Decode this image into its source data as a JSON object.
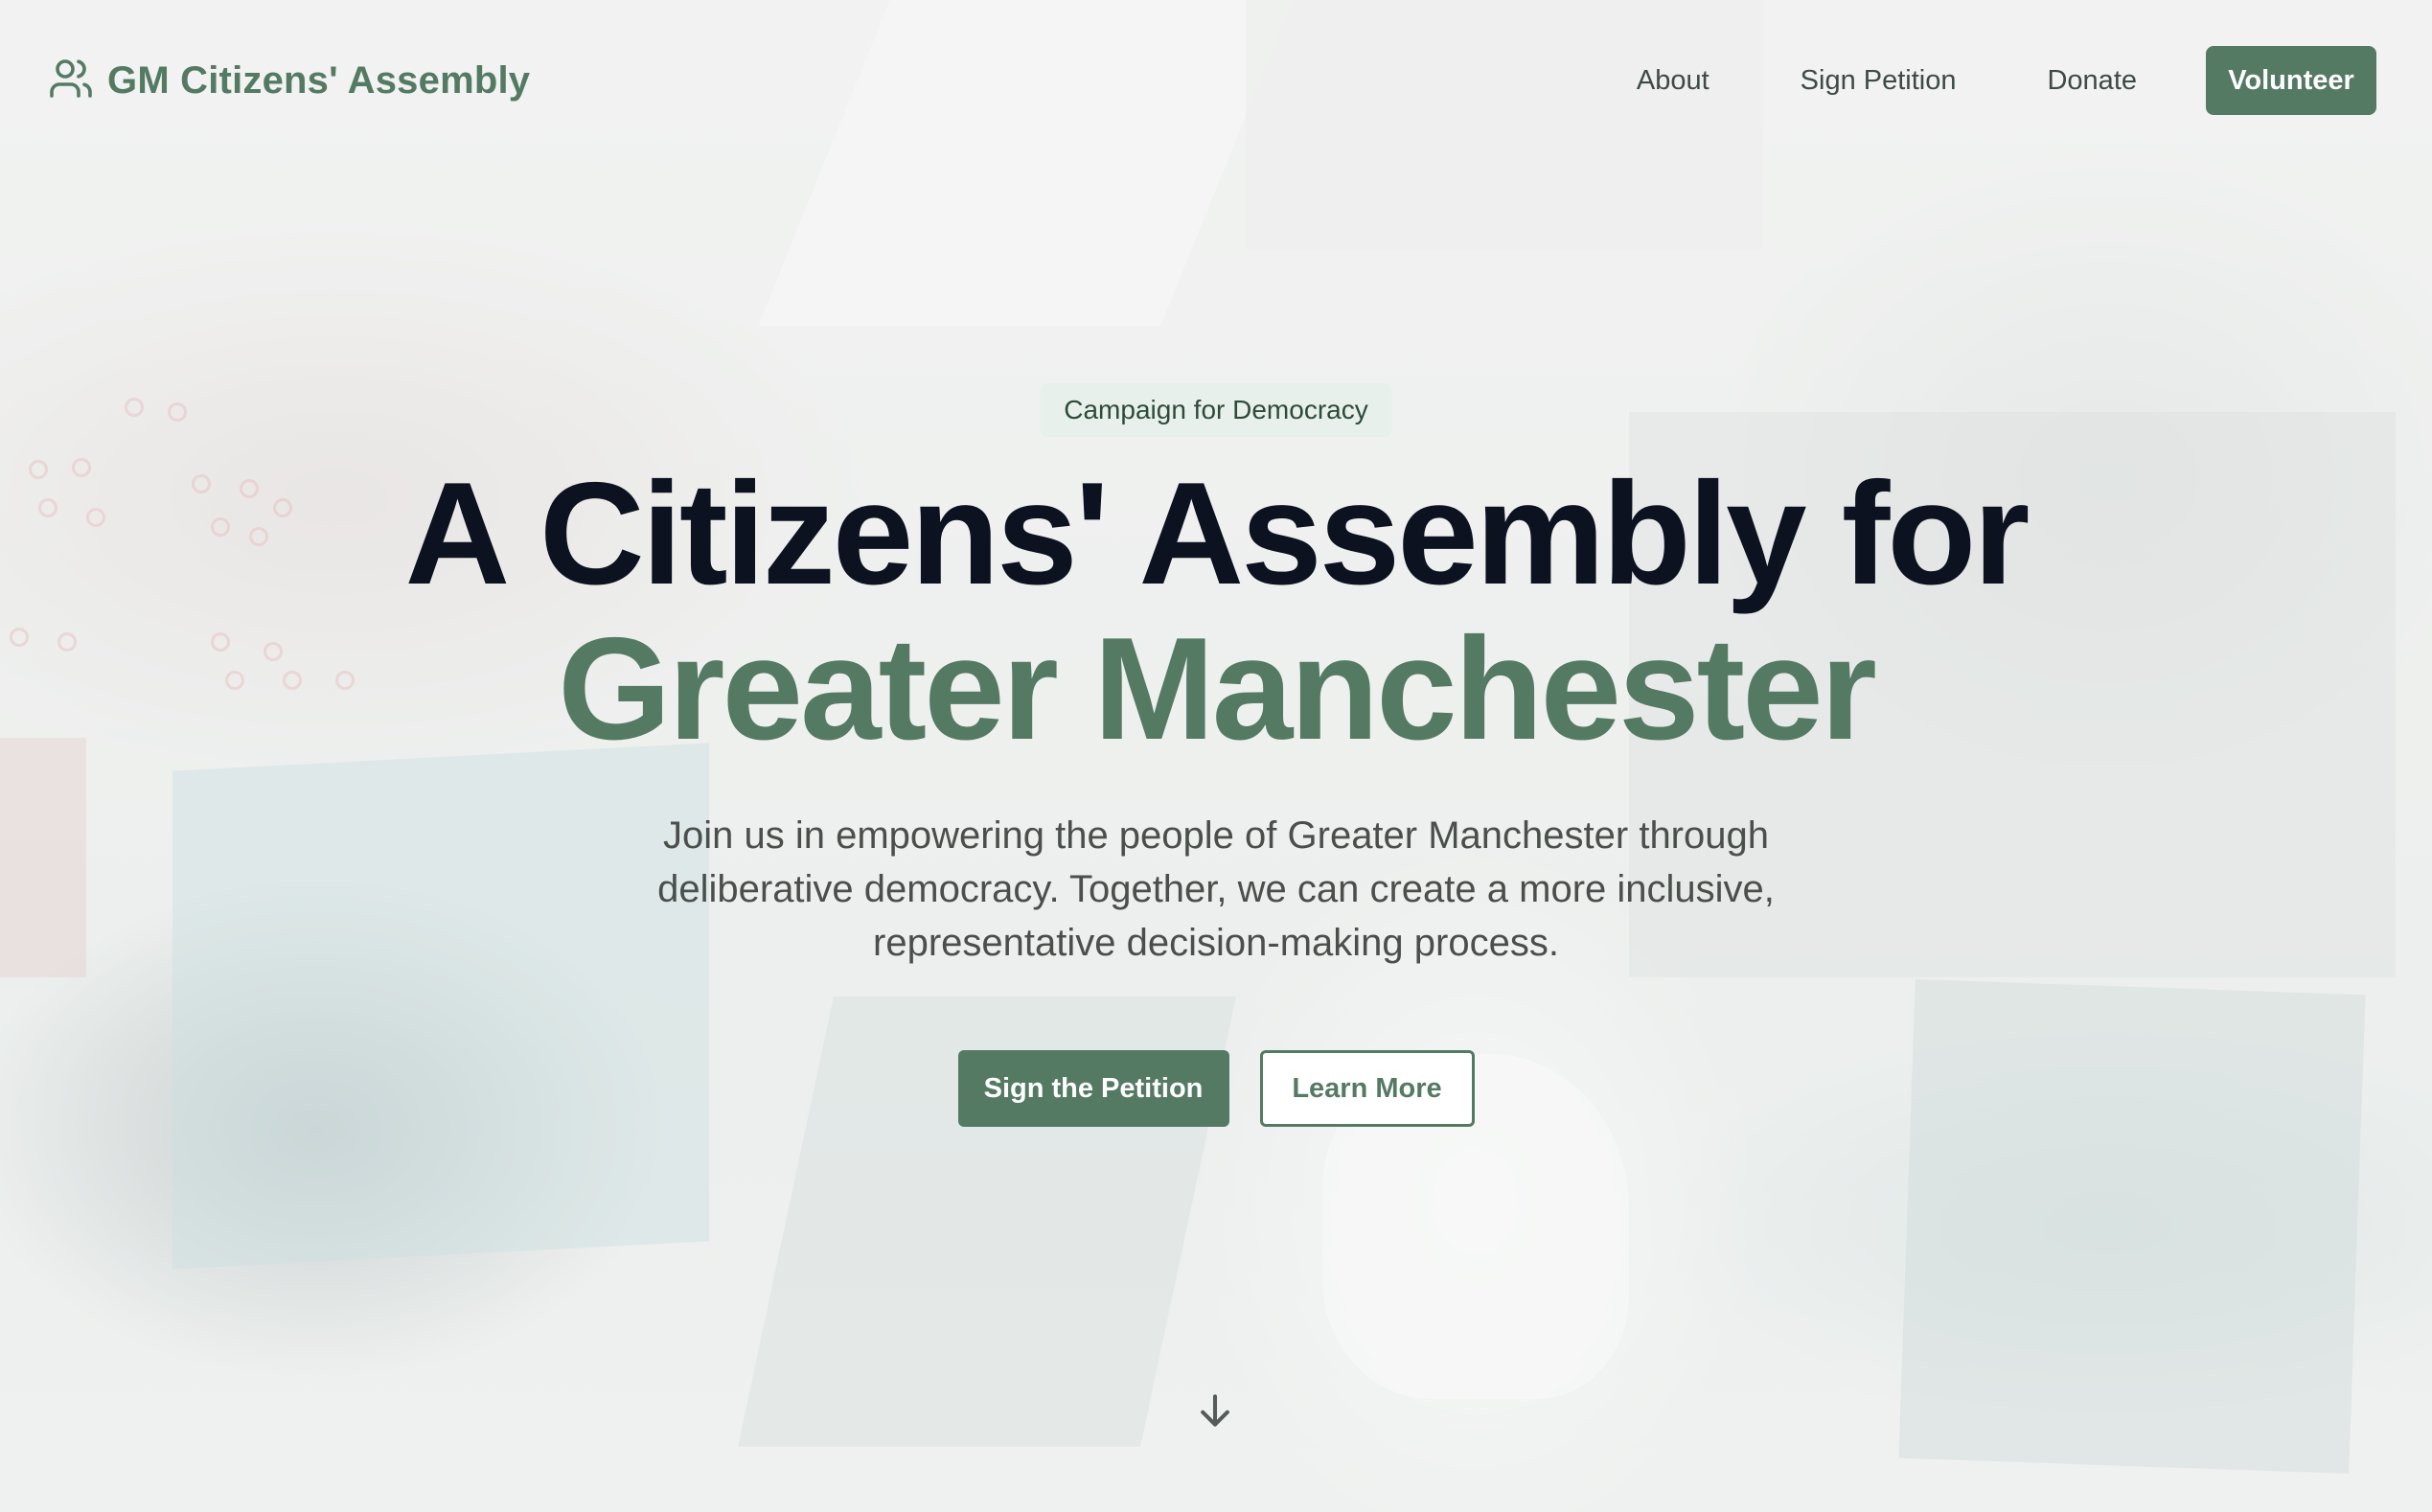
{
  "brand": {
    "name": "GM Citizens' Assembly",
    "icon": "users-icon",
    "color": "#557a64"
  },
  "nav": {
    "links": [
      "About",
      "Sign Petition",
      "Donate"
    ],
    "cta": "Volunteer"
  },
  "hero": {
    "badge": "Campaign for Democracy",
    "title_line1": "A Citizens' Assembly for",
    "title_line2": "Greater Manchester",
    "subtitle": "Join us in empowering the people of Greater Manchester through deliberative democracy. Together, we can create a more inclusive, representative decision-making process.",
    "primary_button": "Sign the Petition",
    "secondary_button": "Learn More",
    "scroll_icon": "arrow-down-icon"
  },
  "colors": {
    "accent": "#557a64",
    "heading": "#0d1220",
    "body_text": "#4a4f4c"
  }
}
